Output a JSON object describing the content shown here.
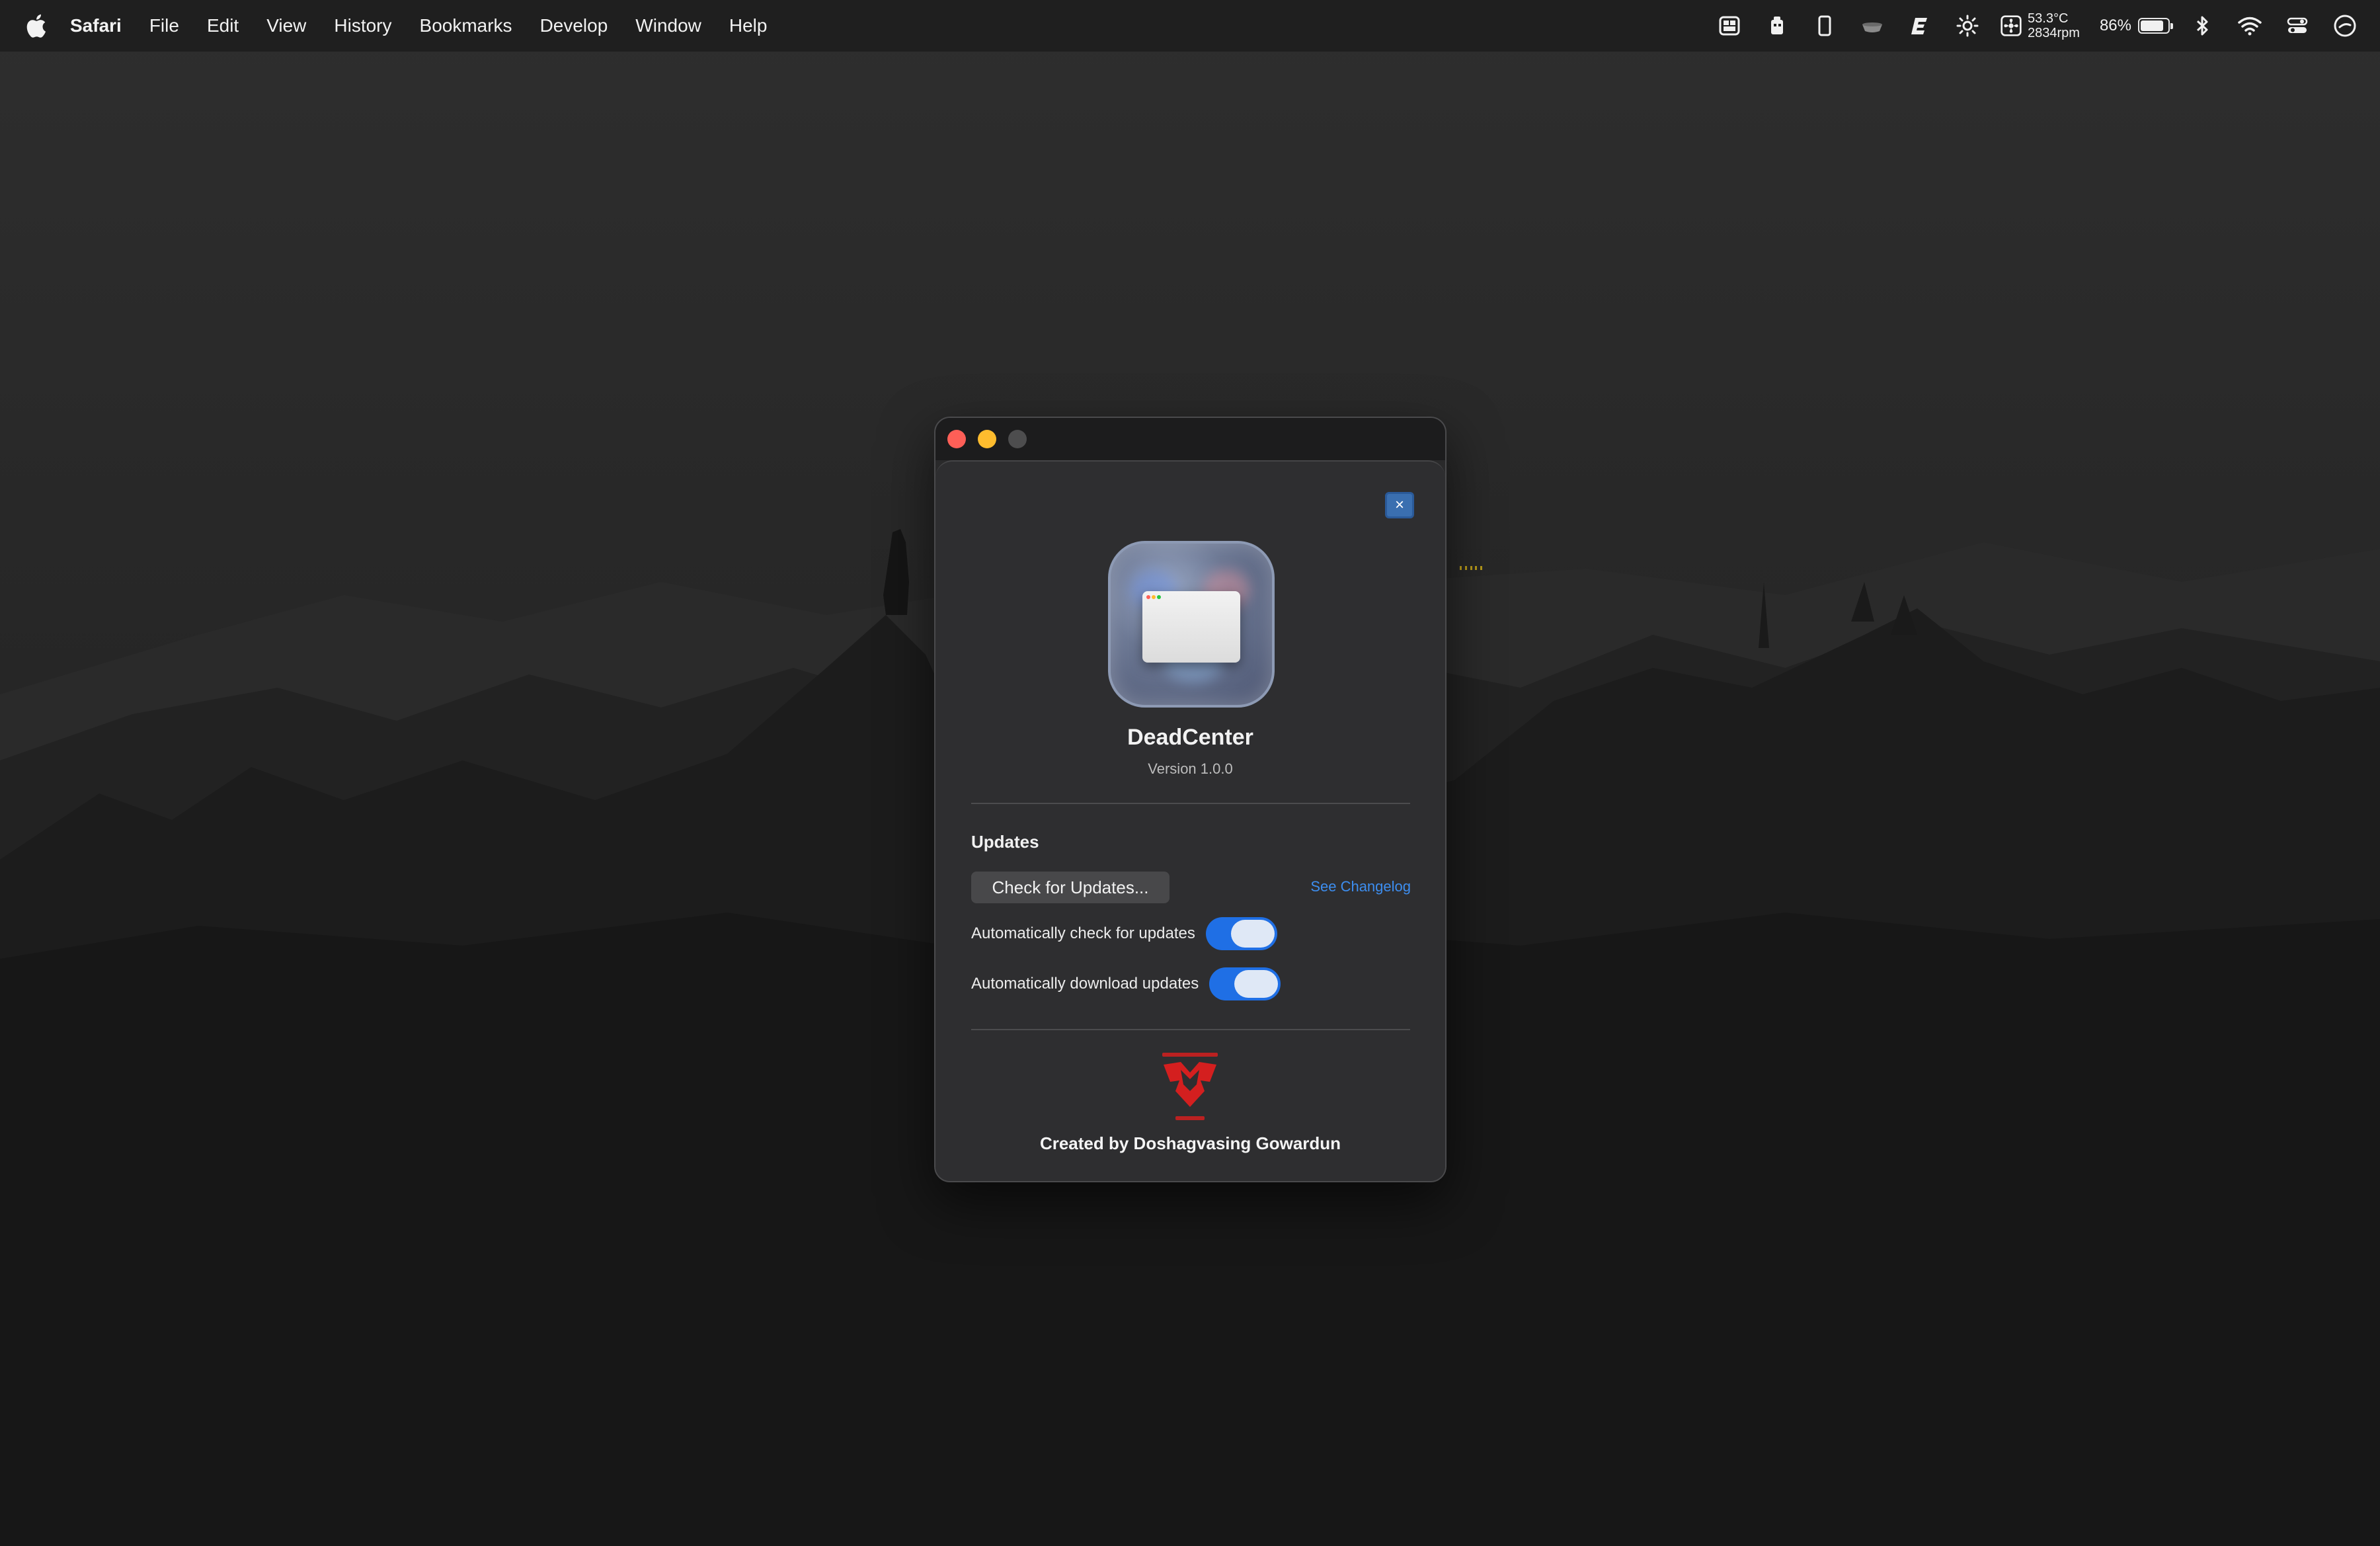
{
  "menubar": {
    "app_name": "Safari",
    "items": [
      "File",
      "Edit",
      "View",
      "History",
      "Bookmarks",
      "Develop",
      "Window",
      "Help"
    ],
    "status": {
      "temperature": "53.3°C",
      "fan_speed": "2834rpm",
      "battery_percent": "86%",
      "battery_level": 0.86,
      "icons": [
        "layout-icon",
        "robot-icon",
        "phone-icon",
        "cup-icon",
        "e-icon",
        "brightness-icon",
        "fan-icon",
        "battery-icon",
        "bluetooth-icon",
        "wifi-icon",
        "control-center-icon",
        "clock-icon"
      ]
    }
  },
  "window": {
    "app_title": "DeadCenter",
    "version": "Version 1.0.0",
    "close_glyph": "×",
    "updates": {
      "section_title": "Updates",
      "check_button": "Check for Updates...",
      "changelog_link": "See Changelog",
      "auto_check_label": "Automatically check for updates",
      "auto_check_enabled": true,
      "auto_download_label": "Automatically download updates",
      "auto_download_enabled": true
    },
    "credit": "Created by Doshagvasing Gowardun"
  },
  "colors": {
    "accent": "#1f6fe5",
    "link": "#3d8ef0",
    "close": "#fe5f57",
    "minimize": "#febc2e",
    "logo_red": "#d41f1f"
  }
}
